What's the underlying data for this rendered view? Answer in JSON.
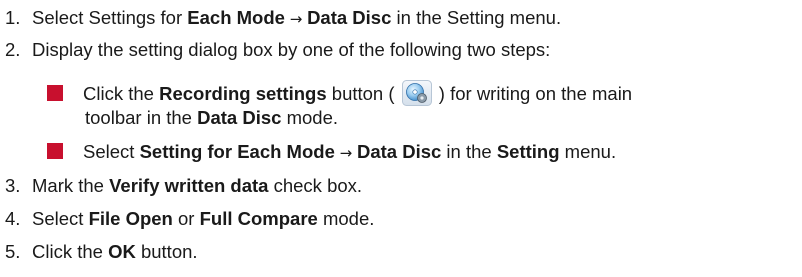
{
  "steps": [
    {
      "num": "1.",
      "pre": "Select Settings for ",
      "b1": "Each Mode",
      "arrow": " → ",
      "b2": "Data Disc",
      "post": " in the Setting menu."
    },
    {
      "num": "2.",
      "text": "Display the setting dialog box by one of the following two steps:"
    },
    {
      "num": "3.",
      "pre": "Mark the ",
      "b1": "Verify written data",
      "post": " check box."
    },
    {
      "num": "4.",
      "pre": "Select ",
      "b1": "File Open",
      "mid": " or ",
      "b2": "Full Compare",
      "post": " mode."
    },
    {
      "num": "5.",
      "pre": "Click the ",
      "b1": "OK",
      "post": " button."
    }
  ],
  "substeps": [
    {
      "pre": "Click the ",
      "b1": "Recording settings",
      "mid": " button ( ",
      "icon": "recording-settings-icon",
      "post": " ) for writing on the main",
      "cont_pre": "toolbar in the ",
      "cont_b": "Data Disc",
      "cont_post": " mode."
    },
    {
      "pre": "Select ",
      "b1": "Setting for Each Mode",
      "arrow": " → ",
      "b2": "Data Disc",
      "mid": " in the ",
      "b3": "Setting",
      "post": " menu."
    }
  ],
  "colors": {
    "bullet": "#c8102e",
    "text": "#1a1a1a"
  }
}
